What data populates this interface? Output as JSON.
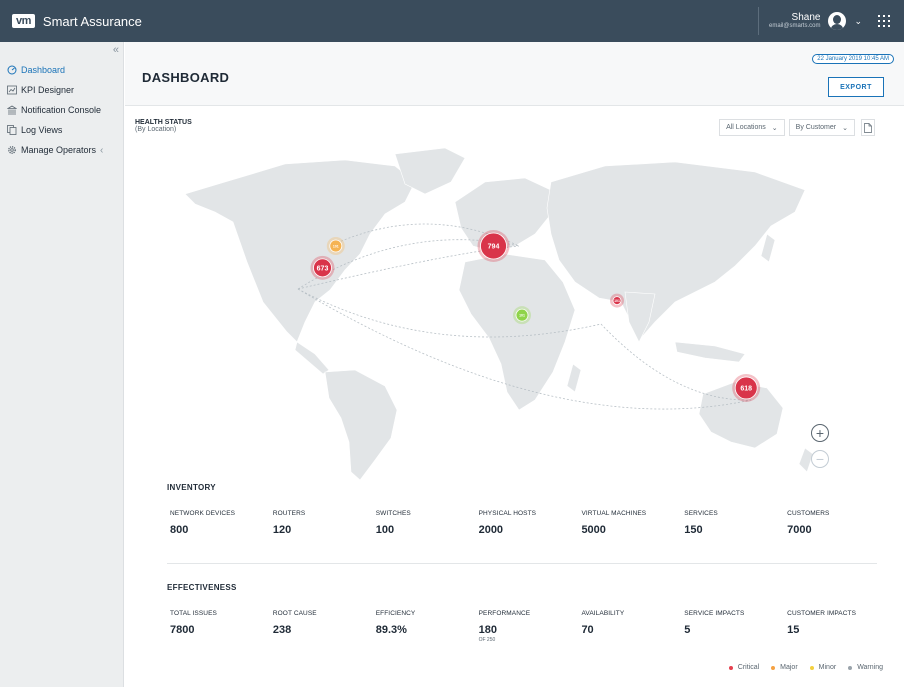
{
  "app": {
    "logo": "vm",
    "title": "Smart Assurance"
  },
  "user": {
    "name": "Shane",
    "email": "email@smarts.com"
  },
  "sidebar": {
    "collapse": "«",
    "items": [
      {
        "label": "Dashboard",
        "icon": "dashboard-icon"
      },
      {
        "label": "KPI Designer",
        "icon": "chart-icon"
      },
      {
        "label": "Notification Console",
        "icon": "bank-icon"
      },
      {
        "label": "Log Views",
        "icon": "copy-icon"
      },
      {
        "label": "Manage Operators",
        "icon": "gear-icon",
        "trail": "‹"
      }
    ]
  },
  "header": {
    "title": "DASHBOARD",
    "datetime": "22 January 2019  10:45 AM",
    "export_label": "EXPORT"
  },
  "health": {
    "title": "HEALTH STATUS",
    "subtitle": "(By Location)",
    "location_filter": "All Locations",
    "customer_filter": "By Customer"
  },
  "map": {
    "markers": [
      {
        "label": "794",
        "severity": "critical",
        "location": "europe",
        "lon": 15,
        "lat": 50
      },
      {
        "label": "673",
        "severity": "critical",
        "location": "north-america-east",
        "lon": -75,
        "lat": 38
      },
      {
        "label": "618",
        "severity": "critical",
        "location": "australia",
        "lon": 148,
        "lat": -28
      },
      {
        "label": "101",
        "severity": "major",
        "location": "north-america-north",
        "lon": -68,
        "lat": 50
      },
      {
        "label": "101",
        "severity": "warning-green",
        "location": "africa",
        "lon": 30,
        "lat": 12
      },
      {
        "label": "101",
        "severity": "critical",
        "location": "india",
        "lon": 80,
        "lat": 20
      }
    ],
    "zoom_in": "+",
    "zoom_out": "−"
  },
  "inventory": {
    "title": "INVENTORY",
    "items": [
      {
        "label": "NETWORK DEVICES",
        "value": "800"
      },
      {
        "label": "ROUTERS",
        "value": "120"
      },
      {
        "label": "SWITCHES",
        "value": "100"
      },
      {
        "label": "PHYSICAL HOSTS",
        "value": "2000"
      },
      {
        "label": "VIRTUAL MACHINES",
        "value": "5000"
      },
      {
        "label": "SERVICES",
        "value": "150"
      },
      {
        "label": "CUSTOMERS",
        "value": "7000"
      }
    ]
  },
  "effectiveness": {
    "title": "EFFECTIVENESS",
    "items": [
      {
        "label": "TOTAL ISSUES",
        "value": "7800"
      },
      {
        "label": "ROOT CAUSE",
        "value": "238"
      },
      {
        "label": "EFFICIENCY",
        "value": "89.3%"
      },
      {
        "label": "PERFORMANCE",
        "value": "180",
        "sub": "OF 250"
      },
      {
        "label": "AVAILABILITY",
        "value": "70"
      },
      {
        "label": "SERVICE IMPACTS",
        "value": "5"
      },
      {
        "label": "CUSTOMER IMPACTS",
        "value": "15"
      }
    ]
  },
  "legend": [
    {
      "label": "Critical",
      "color": "#e5414f"
    },
    {
      "label": "Major",
      "color": "#f5a243"
    },
    {
      "label": "Minor",
      "color": "#f4d03f"
    },
    {
      "label": "Warning",
      "color": "#9aa3ab"
    }
  ],
  "colors": {
    "critical": "#d9344a",
    "major": "#f5b352",
    "warning-green": "#8fd44a",
    "accent": "#1a73b8",
    "topbar": "#3a4c5c"
  }
}
